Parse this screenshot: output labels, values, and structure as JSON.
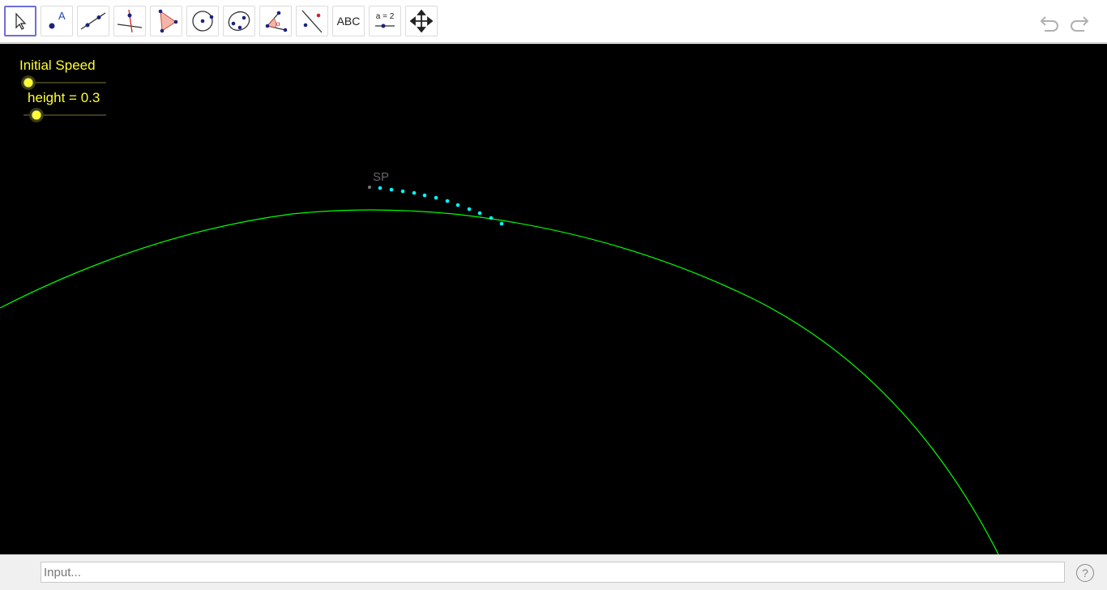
{
  "toolbar": {
    "tools": [
      {
        "name": "move-tool-button",
        "icon": "cursor-arrow-icon"
      },
      {
        "name": "point-tool-button",
        "icon": "point-icon"
      },
      {
        "name": "line-tool-button",
        "icon": "line-through-points-icon"
      },
      {
        "name": "perpendicular-line-tool-button",
        "icon": "perpendicular-line-icon"
      },
      {
        "name": "polygon-tool-button",
        "icon": "polygon-icon"
      },
      {
        "name": "circle-tool-button",
        "icon": "circle-center-point-icon"
      },
      {
        "name": "conic-tool-button",
        "icon": "ellipse-icon"
      },
      {
        "name": "angle-tool-button",
        "icon": "angle-icon"
      },
      {
        "name": "reflect-tool-button",
        "icon": "reflect-about-line-icon"
      },
      {
        "name": "text-tool-button",
        "icon": "text-icon"
      },
      {
        "name": "slider-tool-button",
        "icon": "slider-icon"
      },
      {
        "name": "move-graphics-view-button",
        "icon": "move-arrows-icon"
      }
    ],
    "text_tool_label": "ABC",
    "slider_tool_label": "a = 2",
    "undo_icon": "undo-icon",
    "redo_icon": "redo-icon"
  },
  "canvas": {
    "slider_initial_speed_label": "Initial Speed",
    "slider_height_label": "height = 0.3",
    "point_label": "SP",
    "colors": {
      "background": "#000000",
      "slider_label": "#ffff33",
      "curve": "#00ff00",
      "trail_points": "#00ffff",
      "point_label": "#666666"
    }
  },
  "input_bar": {
    "placeholder": "Input...",
    "help_label": "?"
  }
}
